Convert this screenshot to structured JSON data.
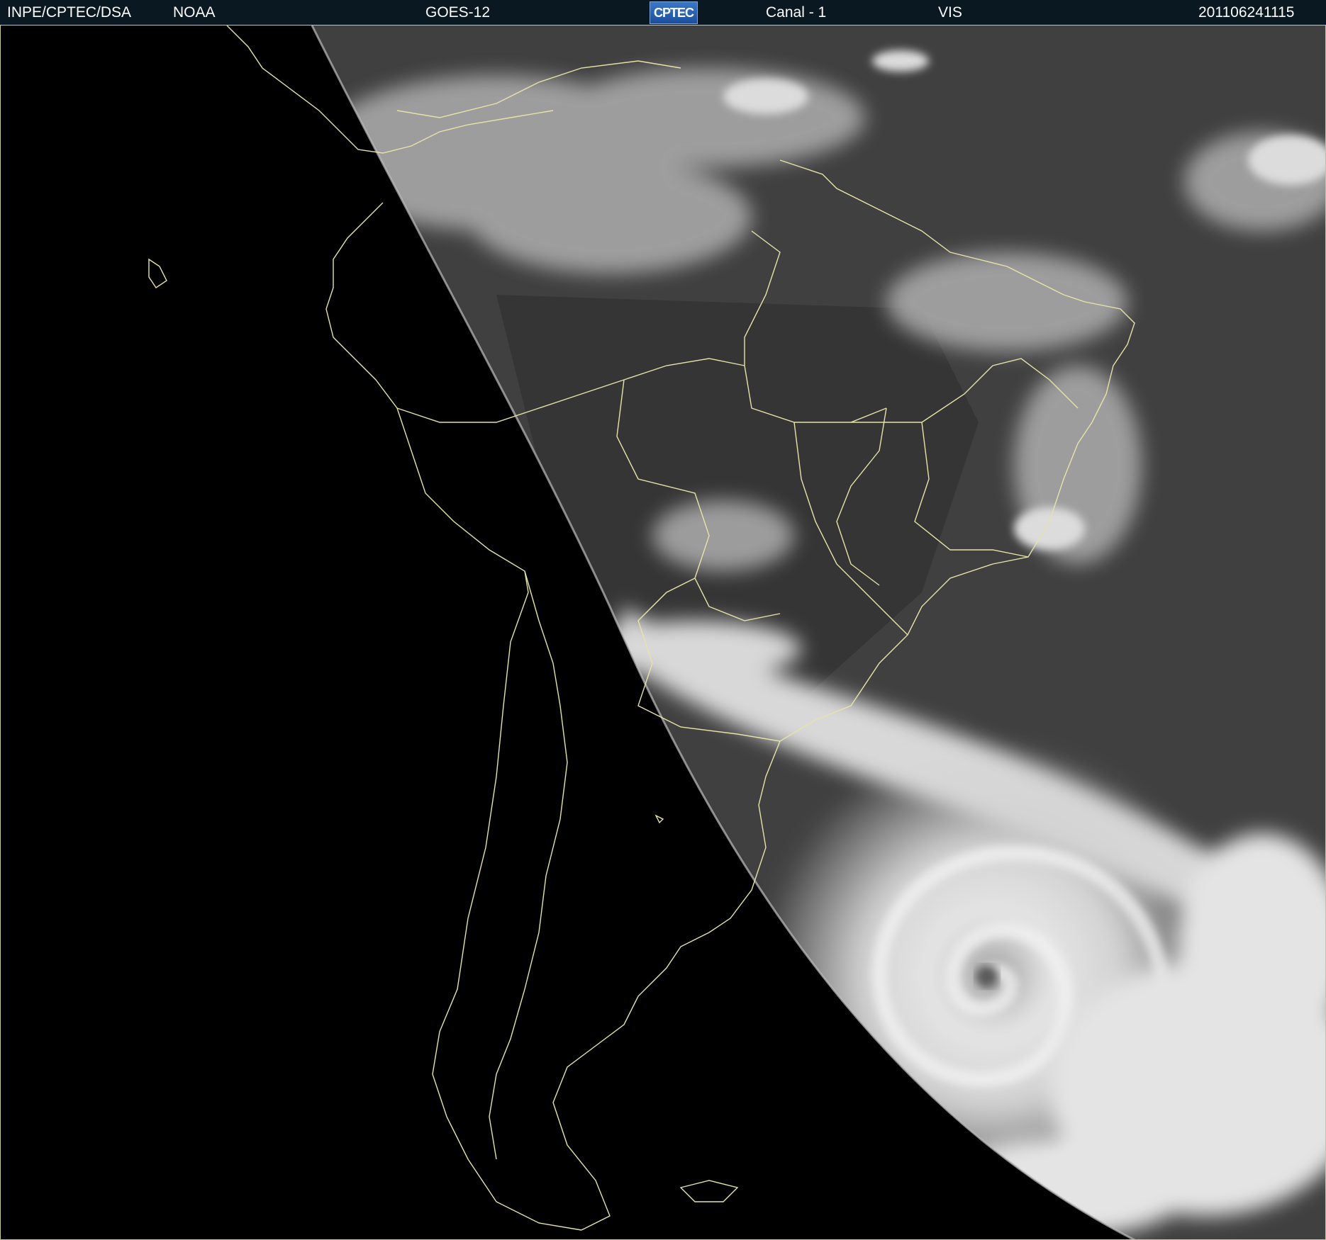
{
  "header": {
    "agency": "INPE/CPTEC/DSA",
    "source": "NOAA",
    "satellite": "GOES-12",
    "logo_text": "CPTEC",
    "channel": "Canal - 1",
    "band": "VIS",
    "timestamp": "201106241115"
  },
  "colors": {
    "header_background": "#0a1822",
    "border_lines": "#c9c78a",
    "space": "#000000",
    "earth_base": "#3c3c3c",
    "clouds": "#e8e8e8"
  },
  "icons": {
    "logo": "cptec-logo"
  }
}
